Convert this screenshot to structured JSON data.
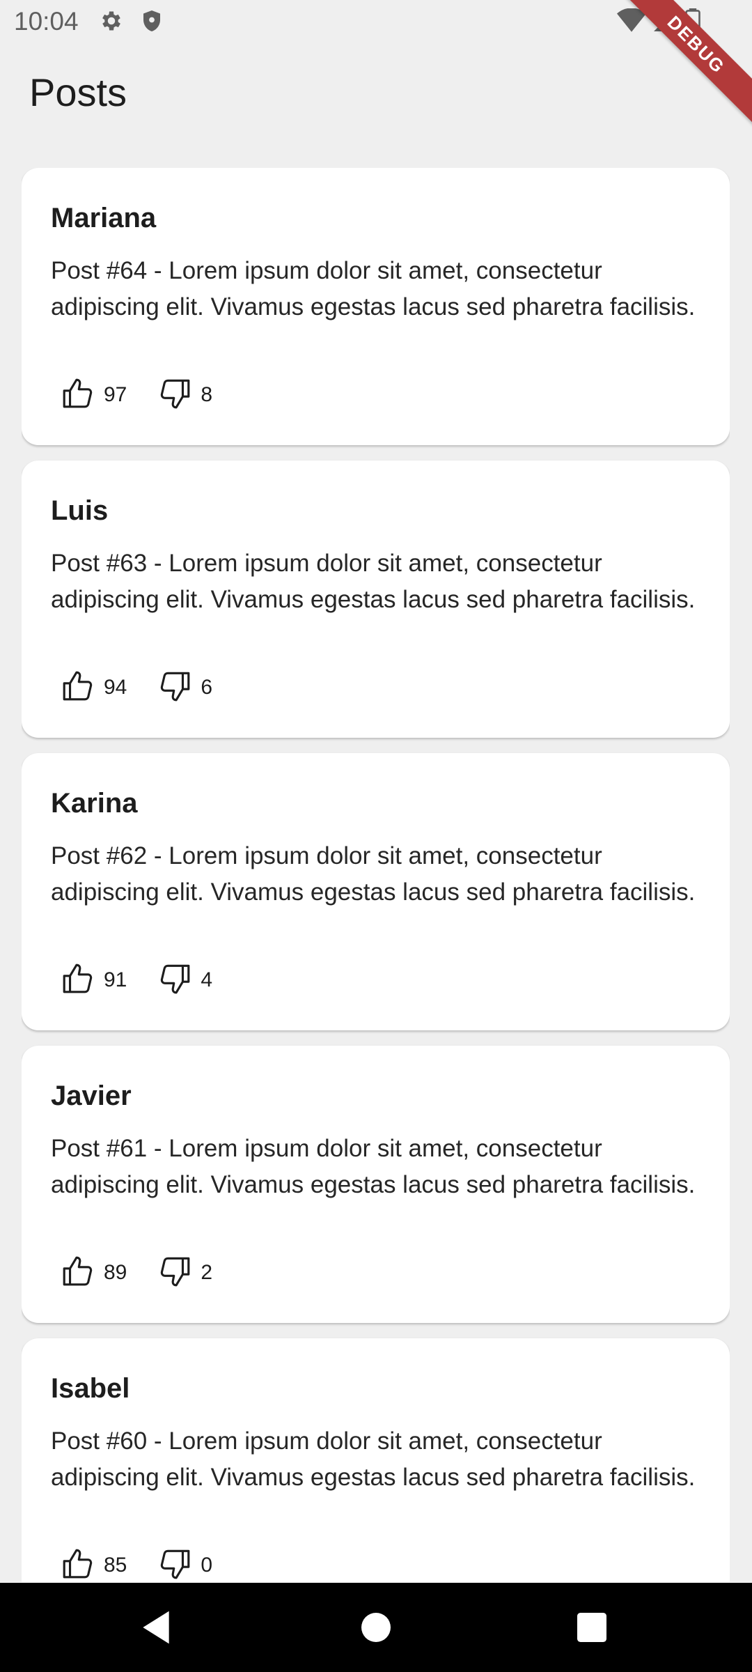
{
  "status_bar": {
    "time": "10:04",
    "icons": [
      "gear-icon",
      "shield-icon",
      "wifi-icon",
      "cell-signal-icon",
      "battery-icon"
    ]
  },
  "debug_banner": "DEBUG",
  "page": {
    "title": "Posts"
  },
  "posts": [
    {
      "author": "Mariana",
      "body": "Post #64 - Lorem ipsum dolor sit amet, consectetur adipiscing elit. Vivamus egestas lacus sed pharetra facilisis.",
      "likes": "97",
      "dislikes": "8"
    },
    {
      "author": "Luis",
      "body": "Post #63 - Lorem ipsum dolor sit amet, consectetur adipiscing elit. Vivamus egestas lacus sed pharetra facilisis.",
      "likes": "94",
      "dislikes": "6"
    },
    {
      "author": "Karina",
      "body": "Post #62 - Lorem ipsum dolor sit amet, consectetur adipiscing elit. Vivamus egestas lacus sed pharetra facilisis.",
      "likes": "91",
      "dislikes": "4"
    },
    {
      "author": "Javier",
      "body": "Post #61 - Lorem ipsum dolor sit amet, consectetur adipiscing elit. Vivamus egestas lacus sed pharetra facilisis.",
      "likes": "89",
      "dislikes": "2"
    },
    {
      "author": "Isabel",
      "body": "Post #60 - Lorem ipsum dolor sit amet, consectetur adipiscing elit. Vivamus egestas lacus sed pharetra facilisis.",
      "likes": "85",
      "dislikes": "0"
    }
  ],
  "nav": [
    "back-icon",
    "home-icon",
    "recents-icon"
  ],
  "colors": {
    "background": "#efefef",
    "card": "#ffffff",
    "debug": "#b23a3a",
    "nav": "#000000"
  }
}
